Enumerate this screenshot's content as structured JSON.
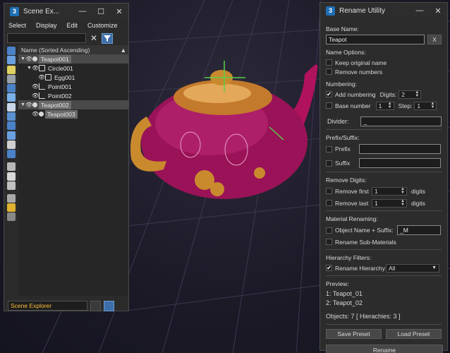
{
  "scene_explorer": {
    "title": "Scene Ex...",
    "menus": [
      "Select",
      "Display",
      "Edit",
      "Customize"
    ],
    "column_header": "Name (Sorted Ascending)",
    "tree": [
      {
        "name": "Teapot001",
        "level": 0,
        "expand": "▼",
        "type": "geometry",
        "selected": true
      },
      {
        "name": "Circle001",
        "level": 1,
        "expand": "▼",
        "type": "shape",
        "selected": false
      },
      {
        "name": "Egg001",
        "level": 2,
        "expand": "",
        "type": "shape",
        "selected": false
      },
      {
        "name": "Point001",
        "level": 1,
        "expand": "",
        "type": "helper",
        "selected": false
      },
      {
        "name": "Point002",
        "level": 1,
        "expand": "",
        "type": "helper",
        "selected": false
      },
      {
        "name": "Teapot002",
        "level": 0,
        "expand": "▼",
        "type": "geometry",
        "selected": true
      },
      {
        "name": "Teapot003",
        "level": 1,
        "expand": "",
        "type": "geometry",
        "selected": true
      }
    ],
    "scene_name": "Scene Explorer"
  },
  "rename_utility": {
    "title": "Rename Utility",
    "base_name_label": "Base Name:",
    "base_name_value": "Teapot",
    "clear_button": "X",
    "name_options_label": "Name Options:",
    "keep_original": "Keep original name",
    "remove_numbers": "Remove numbers",
    "numbering_label": "Numbering:",
    "add_numbering": "Add numbering",
    "digits_label": "Digits:",
    "digits_value": "2",
    "base_number_label": "Base number",
    "base_number_value": "1",
    "step_label": "Step:",
    "step_value": "1",
    "divider_label": "Divider:",
    "divider_value": "_",
    "prefix_suffix_label": "Prefix/Suffix:",
    "prefix_label": "Prefix",
    "suffix_label": "Suffix",
    "remove_digits_label": "Remove Digits:",
    "remove_first": "Remove first",
    "remove_first_value": "1",
    "remove_last": "Remove last",
    "remove_last_value": "1",
    "digits_unit": "digits",
    "material_label": "Material Renaming:",
    "object_suffix": "Object Name + Suffix:",
    "object_suffix_value": "_M",
    "rename_sub": "Rename Sub-Materials",
    "hierarchy_label": "Hierarchy Filters:",
    "rename_hierarchy": "Rename Hierarchy",
    "hierarchy_option": "All",
    "preview_label": "Preview:",
    "preview_1": "1: Teapot_01",
    "preview_2": "2: Teapot_02",
    "objects_summary": "Objects: 7  [ Hierachies: 3 ]",
    "save_preset": "Save Preset",
    "load_preset": "Load Preset",
    "rename_button": "Rename"
  },
  "colors": {
    "accent": "#3f6fa8",
    "selection": "#6a6a6a",
    "teapot": "#b0125e",
    "handle_gold": "#c98a2e"
  }
}
